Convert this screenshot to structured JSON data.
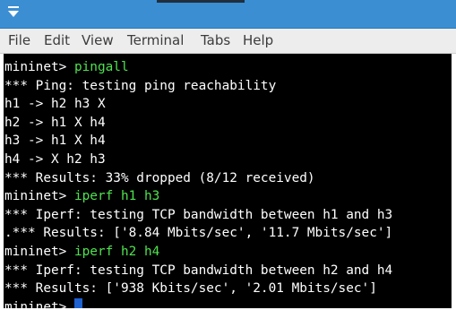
{
  "window": {
    "menu_glyph": "▼",
    "titlebar_color": "#3b8ed2"
  },
  "menubar": {
    "items": [
      "File",
      "Edit",
      "View",
      "Terminal",
      "Tabs",
      "Help"
    ]
  },
  "terminal": {
    "colors": {
      "background": "#000000",
      "prompt": "#ffffff",
      "command": "#4fe24f",
      "output": "#ffffff",
      "cursor": "#1e62d2"
    },
    "lines": [
      {
        "prompt": "mininet> ",
        "command": "pingall"
      },
      {
        "text": "*** Ping: testing ping reachability"
      },
      {
        "text": "h1 -> h2 h3 X"
      },
      {
        "text": "h2 -> h1 X h4"
      },
      {
        "text": "h3 -> h1 X h4"
      },
      {
        "text": "h4 -> X h2 h3"
      },
      {
        "text": "*** Results: 33% dropped (8/12 received)"
      },
      {
        "prompt": "mininet> ",
        "command": "iperf h1 h3"
      },
      {
        "text": "*** Iperf: testing TCP bandwidth between h1 and h3"
      },
      {
        "text": ".*** Results: ['8.84 Mbits/sec', '11.7 Mbits/sec']"
      },
      {
        "prompt": "mininet> ",
        "command": "iperf h2 h4"
      },
      {
        "text": "*** Iperf: testing TCP bandwidth between h2 and h4"
      },
      {
        "text": "*** Results: ['938 Kbits/sec', '2.01 Mbits/sec']"
      },
      {
        "prompt": "mininet> ",
        "command": ""
      }
    ]
  }
}
